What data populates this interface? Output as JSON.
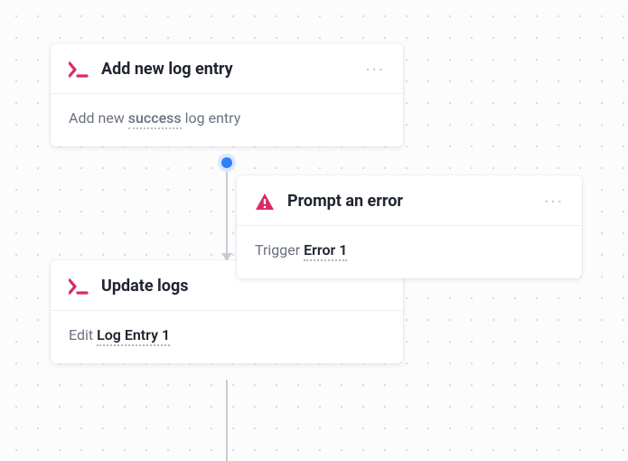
{
  "nodes": {
    "add_log": {
      "title": "Add new log entry",
      "body_prefix": "Add new ",
      "body_highlight": "success",
      "body_suffix": " log entry"
    },
    "update_logs": {
      "title": "Update logs",
      "body_prefix": "Edit ",
      "body_highlight": "Log Entry 1"
    },
    "prompt_error": {
      "title": "Prompt an error",
      "body_prefix": "Trigger ",
      "body_highlight": "Error 1"
    }
  }
}
